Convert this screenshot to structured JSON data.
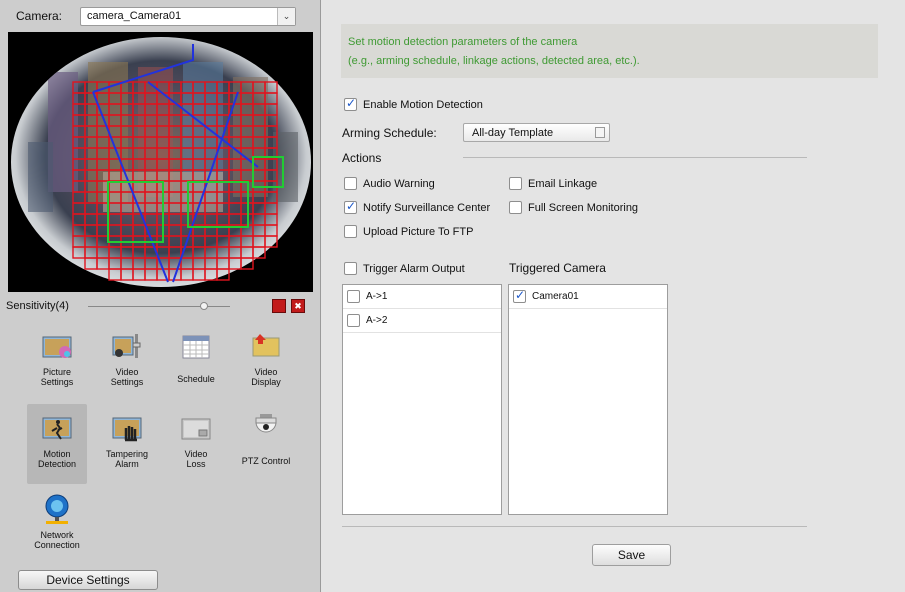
{
  "camera": {
    "label": "Camera:",
    "value": "camera_Camera01"
  },
  "sensitivity": {
    "label": "Sensitivity(4)",
    "level": 4,
    "max": 5
  },
  "tiles": [
    {
      "lines": [
        "Picture",
        "Settings"
      ],
      "icon": "picture-settings-icon"
    },
    {
      "lines": [
        "Video",
        "Settings"
      ],
      "icon": "video-settings-icon"
    },
    {
      "lines": [
        "Schedule"
      ],
      "icon": "schedule-icon"
    },
    {
      "lines": [
        "Video",
        "Display"
      ],
      "icon": "video-display-icon"
    },
    {
      "lines": [
        "Motion",
        "Detection"
      ],
      "icon": "motion-detection-icon",
      "active": true
    },
    {
      "lines": [
        "Tampering",
        "Alarm"
      ],
      "icon": "tampering-alarm-icon"
    },
    {
      "lines": [
        "Video",
        "Loss"
      ],
      "icon": "video-loss-icon"
    },
    {
      "lines": [
        "PTZ Control"
      ],
      "icon": "ptz-control-icon"
    },
    {
      "lines": [
        "Network",
        "Connection"
      ],
      "icon": "network-connection-icon"
    }
  ],
  "device_settings": "Device Settings",
  "info": {
    "line1": "Set motion detection parameters of the camera",
    "line2": "(e.g., arming schedule, linkage actions, detected area, etc.)."
  },
  "enable_motion": {
    "label": "Enable Motion Detection",
    "checked": true
  },
  "arming": {
    "label": "Arming Schedule:",
    "value": "All-day Template"
  },
  "actions": {
    "label": "Actions",
    "audio_warning": {
      "label": "Audio Warning",
      "checked": false
    },
    "email_linkage": {
      "label": "Email Linkage",
      "checked": false
    },
    "notify_center": {
      "label": "Notify Surveillance Center",
      "checked": true
    },
    "full_screen": {
      "label": "Full Screen Monitoring",
      "checked": false
    },
    "upload_ftp": {
      "label": "Upload Picture To FTP",
      "checked": false
    }
  },
  "trigger_alarm": {
    "label": "Trigger Alarm Output",
    "checked": false
  },
  "alarm_outputs": [
    {
      "label": "A->1",
      "checked": false
    },
    {
      "label": "A->2",
      "checked": false
    }
  ],
  "triggered_camera": {
    "label": "Triggered Camera",
    "items": [
      {
        "label": "Camera01",
        "checked": true
      }
    ]
  },
  "save": "Save",
  "colors": {
    "accent_green": "#3f9a33",
    "grid_red": "#e0141e",
    "area_blue": "#2233dd",
    "area_green": "#22cc33",
    "check_blue": "#1b57c9"
  }
}
